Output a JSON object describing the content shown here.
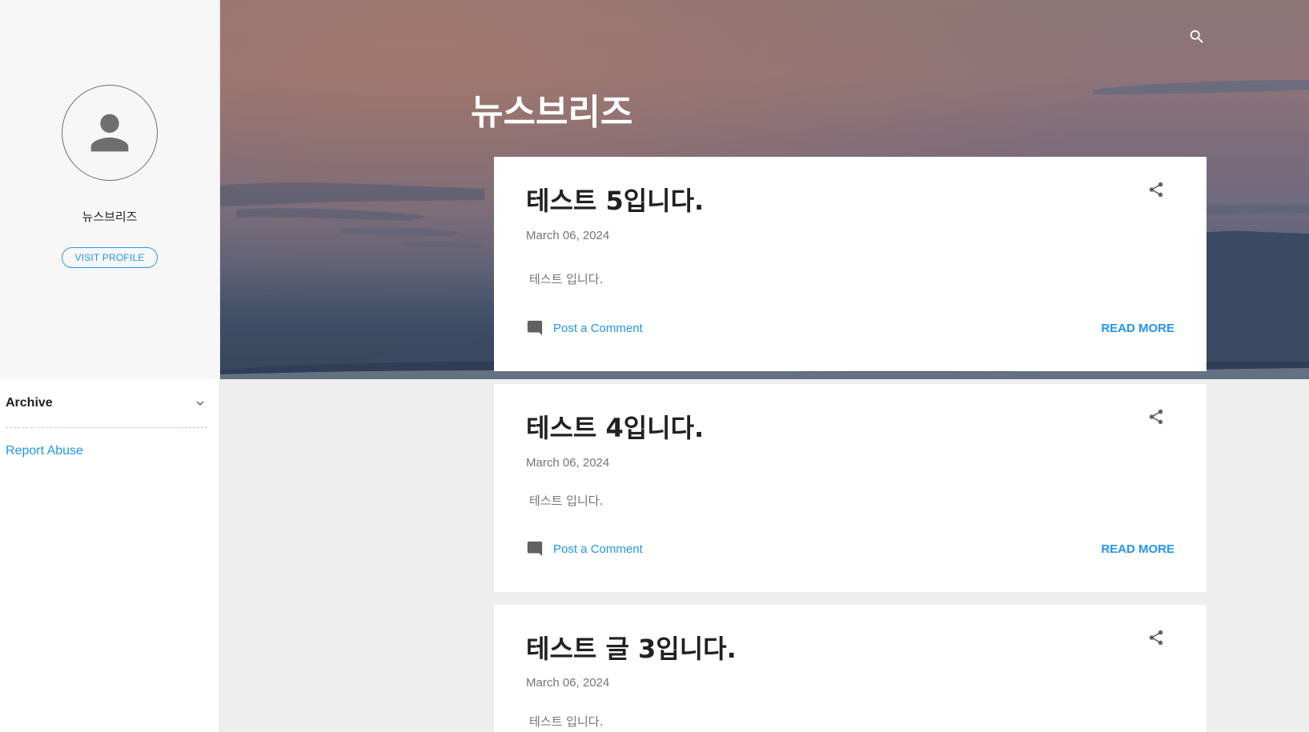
{
  "blog": {
    "title": "뉴스브리즈"
  },
  "profile": {
    "name": "뉴스브리즈",
    "visit_label": "VISIT PROFILE"
  },
  "sidebar": {
    "archive_label": "Archive",
    "report_abuse_label": "Report Abuse"
  },
  "posts": [
    {
      "title": "테스트 5입니다.",
      "date": "March 06, 2024",
      "snippet": "테스트 입니다.",
      "comment_label": "Post a Comment",
      "read_more_label": "READ MORE"
    },
    {
      "title": "테스트 4입니다.",
      "date": "March 06, 2024",
      "snippet": "테스트 입니다.",
      "comment_label": "Post a Comment",
      "read_more_label": "READ MORE"
    },
    {
      "title": "테스트 글 3입니다.",
      "date": "March 06, 2024",
      "snippet": "테스트 입니다."
    }
  ],
  "icons": {
    "search": "search-icon",
    "share": "share-icon",
    "comment": "comment-icon",
    "avatar": "person-icon",
    "archive_toggle": "chevron-down-icon"
  },
  "colors": {
    "accent": "#2196f3",
    "text_primary": "#212121",
    "text_secondary": "#757575",
    "page_background": "#eeeeee",
    "sidebar_profile_background": "#f7f7f7"
  }
}
